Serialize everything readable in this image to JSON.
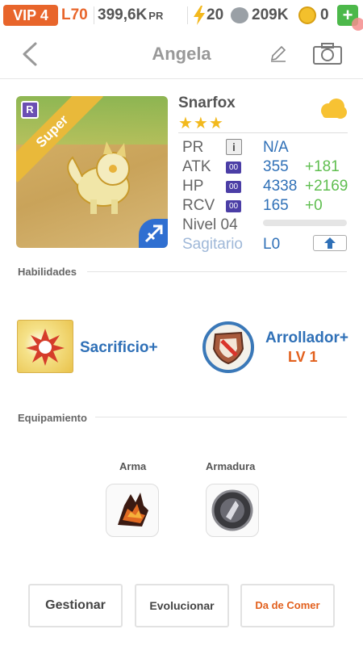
{
  "status": {
    "vip": "VIP 4",
    "level": "L70",
    "power": "399,6K",
    "power_unit": "PR",
    "energy": "20",
    "food": "209K",
    "coins": "0",
    "plus": "+"
  },
  "header": {
    "title": "Angela"
  },
  "pet": {
    "name": "Snarfox",
    "rarity": "R",
    "grade": "Super",
    "stars": "★★★",
    "stats": {
      "pr": {
        "label": "PR",
        "value": "N/A",
        "info": "i"
      },
      "atk": {
        "label": "ATK",
        "badge": "00",
        "value": "355",
        "bonus": "+181"
      },
      "hp": {
        "label": "HP",
        "badge": "00",
        "value": "4338",
        "bonus": "+2169"
      },
      "rcv": {
        "label": "RCV",
        "badge": "00",
        "value": "165",
        "bonus": "+0"
      },
      "level": {
        "label": "Nivel 04",
        "progress": 0
      },
      "sign": {
        "label": "Sagitario",
        "value": "L0"
      }
    }
  },
  "skills": {
    "title": "Habilidades",
    "items": [
      {
        "name": "Sacrificio+"
      },
      {
        "name": "Arrollador+",
        "level": "LV 1"
      }
    ]
  },
  "equipment": {
    "title": "Equipamiento",
    "weapon_label": "Arma",
    "armor_label": "Armadura"
  },
  "actions": {
    "manage": "Gestionar",
    "evolve": "Evolucionar",
    "feed": "Da de Comer"
  },
  "colors": {
    "accent_orange": "#e8652b",
    "link_blue": "#2f70b7",
    "bonus_green": "#5fbe4f",
    "star_gold": "#f2b91d"
  }
}
